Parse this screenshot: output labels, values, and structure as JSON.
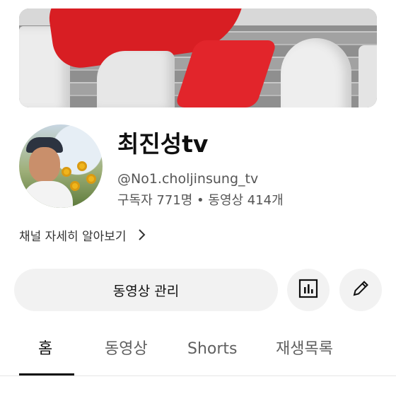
{
  "channel": {
    "title": "최진성tv",
    "handle": "@No1.choljinsung_tv",
    "stats": "구독자 771명 • 동영상 414개"
  },
  "about_link": {
    "label": "채널 자세히 알아보기",
    "icon": "chevron-right-icon"
  },
  "actions": {
    "manage_videos_label": "동영상 관리",
    "stats_icon": "analytics-icon",
    "edit_icon": "pencil-icon"
  },
  "tabs": [
    {
      "label": "홈",
      "active": true
    },
    {
      "label": "동영상",
      "active": false
    },
    {
      "label": "Shorts",
      "active": false
    },
    {
      "label": "재생목록",
      "active": false
    }
  ],
  "colors": {
    "text_primary": "#0f0f0f",
    "text_secondary": "#606060",
    "button_bg": "#f2f2f2",
    "banner_accent": "#d81e23"
  }
}
